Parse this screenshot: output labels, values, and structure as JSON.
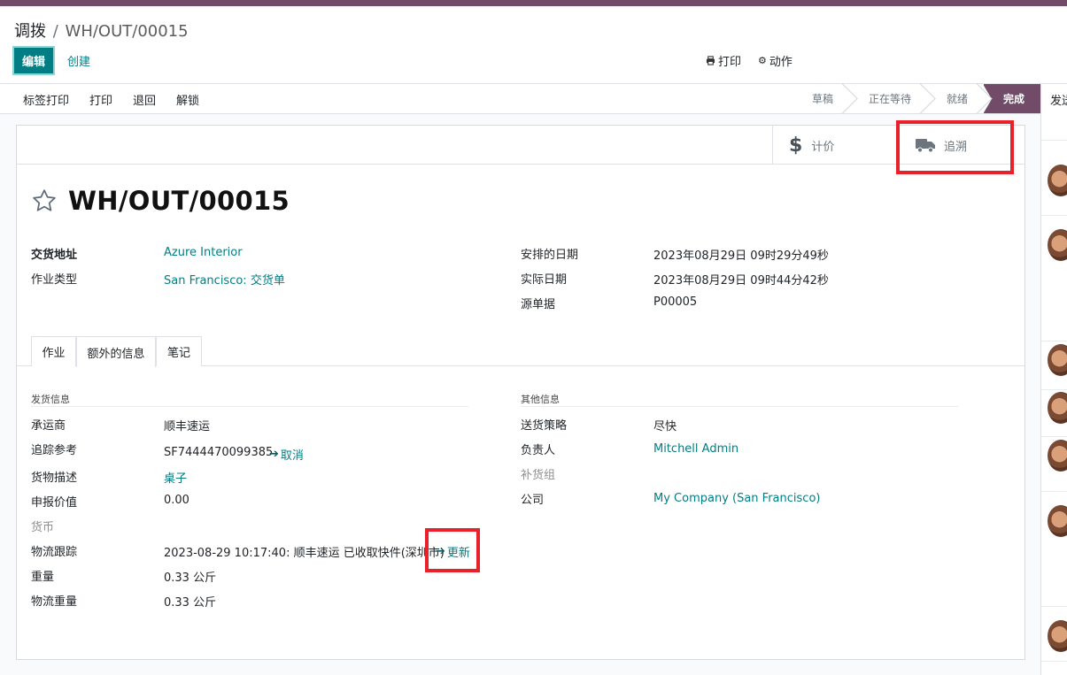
{
  "breadcrumb": {
    "parent": "调拨",
    "current": "WH/OUT/00015"
  },
  "control": {
    "edit": "编辑",
    "create": "创建",
    "print": "打印",
    "action": "动作"
  },
  "statusbar": {
    "buttons": [
      "标签打印",
      "打印",
      "退回",
      "解锁"
    ],
    "stages": [
      "草稿",
      "正在等待",
      "就绪",
      "完成"
    ],
    "active_stage": "完成"
  },
  "smart_buttons": {
    "valuation": "计价",
    "traceability": "追溯"
  },
  "record": {
    "title": "WH/OUT/00015",
    "delivery_address_label": "交货地址",
    "delivery_address": "Azure Interior",
    "operation_type_label": "作业类型",
    "operation_type": "San Francisco: 交货单",
    "scheduled_date_label": "安排的日期",
    "scheduled_date": "2023年08月29日 09时29分49秒",
    "effective_date_label": "实际日期",
    "effective_date": "2023年08月29日 09时44分42秒",
    "origin_label": "源单据",
    "origin": "P00005"
  },
  "tabs": [
    "作业",
    "额外的信息",
    "笔记"
  ],
  "active_tab": "额外的信息",
  "shipping": {
    "section": "发货信息",
    "carrier_label": "承运商",
    "carrier": "顺丰速运",
    "tracking_ref_label": "追踪参考",
    "tracking_ref": "SF7444470099385",
    "cancel": "取消",
    "goods_desc_label": "货物描述",
    "goods_desc": "桌子",
    "declared_value_label": "申报价值",
    "declared_value": "0.00",
    "currency_label": "货币",
    "logistics_label": "物流跟踪",
    "logistics": "2023-08-29 10:17:40: 顺丰速运 已收取快件(深圳市)",
    "update": "更新",
    "weight_label": "重量",
    "weight": "0.33 公斤",
    "shipping_weight_label": "物流重量",
    "shipping_weight": "0.33 公斤"
  },
  "other": {
    "section": "其他信息",
    "policy_label": "送货策略",
    "policy": "尽快",
    "responsible_label": "负责人",
    "responsible": "Mitchell Admin",
    "procurement_label": "补货组",
    "company_label": "公司",
    "company": "My Company (San Francisco)"
  },
  "chatter": {
    "send": "发送消息"
  },
  "colors": {
    "brand": "#714b67",
    "primary": "#017e84",
    "highlight": "#e8212b"
  }
}
